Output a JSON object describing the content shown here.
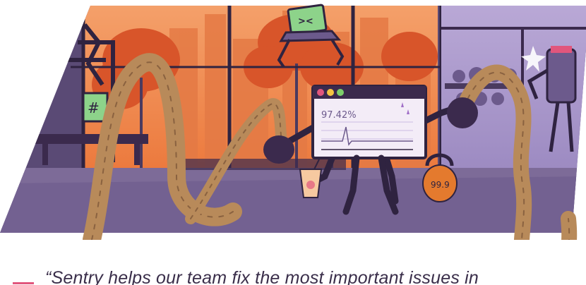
{
  "illustration": {
    "laptop_stat": "97.42%",
    "kettlebell_label": "99.9",
    "colors": {
      "sky_orange": "#f08a4b",
      "deep_orange": "#e4632e",
      "purple_dark": "#3b2a4d",
      "purple_mid": "#6c5a8c",
      "lavender": "#cbbde3",
      "rope": "#b88a5a",
      "floor": "#7d6b98"
    },
    "icons": [
      "laptop-character-icon",
      "phone-character-icon",
      "window-close-dot",
      "window-minimize-dot",
      "window-maximize-dot"
    ]
  },
  "testimonial": {
    "quote": "“Sentry helps our team fix the most important issues in"
  }
}
